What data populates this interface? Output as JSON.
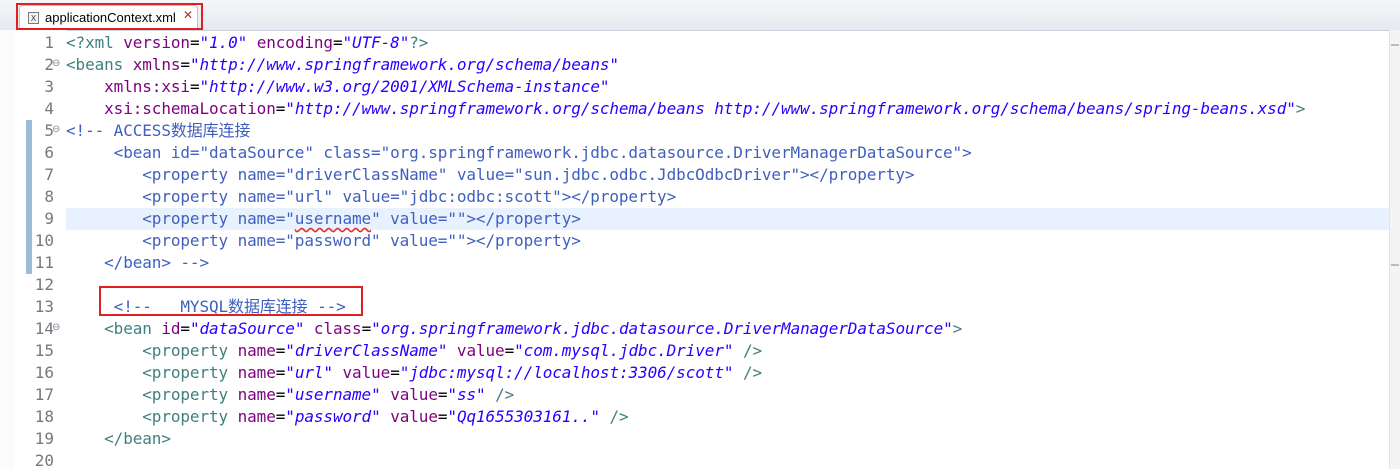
{
  "tab": {
    "title": "applicationContext.xml"
  },
  "lines": [
    {
      "n": "1",
      "fold": "",
      "hl": false,
      "segs": [
        [
          "t",
          "<?xml "
        ],
        [
          "a",
          "version"
        ],
        [
          "p",
          "="
        ],
        [
          "v",
          "\"1.0\""
        ],
        [
          "p",
          " "
        ],
        [
          "a",
          "encoding"
        ],
        [
          "p",
          "="
        ],
        [
          "v",
          "\"UTF-8\""
        ],
        [
          "t",
          "?>"
        ]
      ]
    },
    {
      "n": "2",
      "fold": "⊖",
      "hl": false,
      "segs": [
        [
          "t",
          "<beans "
        ],
        [
          "a",
          "xmlns"
        ],
        [
          "p",
          "="
        ],
        [
          "v",
          "\"http://www.springframework.org/schema/beans\""
        ]
      ]
    },
    {
      "n": "3",
      "fold": "",
      "hl": false,
      "segs": [
        [
          "p",
          "    "
        ],
        [
          "a",
          "xmlns:xsi"
        ],
        [
          "p",
          "="
        ],
        [
          "v",
          "\"http://www.w3.org/2001/XMLSchema-instance\""
        ]
      ]
    },
    {
      "n": "4",
      "fold": "",
      "hl": false,
      "segs": [
        [
          "p",
          "    "
        ],
        [
          "a",
          "xsi:schemaLocation"
        ],
        [
          "p",
          "="
        ],
        [
          "v",
          "\"http://www.springframework.org/schema/beans http://www.springframework.org/schema/beans/spring-beans.xsd\""
        ],
        [
          "t",
          ">"
        ]
      ]
    },
    {
      "n": "5",
      "fold": "⊖",
      "hl": false,
      "segs": [
        [
          "c",
          "<!-- ACCESS数据库连接"
        ]
      ]
    },
    {
      "n": "6",
      "fold": "",
      "hl": false,
      "segs": [
        [
          "c",
          "     <bean id=\"dataSource\" class=\"org.springframework.jdbc.datasource.DriverManagerDataSource\">"
        ]
      ]
    },
    {
      "n": "7",
      "fold": "",
      "hl": false,
      "segs": [
        [
          "c",
          "        <property name=\"driverClassName\" value=\"sun.jdbc.odbc.JdbcOdbcDriver\"></property>"
        ]
      ]
    },
    {
      "n": "8",
      "fold": "",
      "hl": false,
      "segs": [
        [
          "c",
          "        <property name=\"url\" value=\"jdbc:odbc:scott\"></property>"
        ]
      ]
    },
    {
      "n": "9",
      "fold": "",
      "hl": true,
      "segs": [
        [
          "c",
          "        <property name=\""
        ],
        [
          "cs",
          "username"
        ],
        [
          "c",
          "\" value=\"\"></property>"
        ]
      ]
    },
    {
      "n": "10",
      "fold": "",
      "hl": false,
      "segs": [
        [
          "c",
          "        <property name=\"password\" value=\"\"></property>"
        ]
      ]
    },
    {
      "n": "11",
      "fold": "",
      "hl": false,
      "segs": [
        [
          "c",
          "    </bean> -->"
        ]
      ]
    },
    {
      "n": "12",
      "fold": "",
      "hl": false,
      "segs": []
    },
    {
      "n": "13",
      "fold": "",
      "hl": false,
      "segs": [
        [
          "c",
          "     <!--   MYSQL数据库连接 -->"
        ]
      ]
    },
    {
      "n": "14",
      "fold": "⊖",
      "hl": false,
      "segs": [
        [
          "p",
          "    "
        ],
        [
          "t",
          "<bean "
        ],
        [
          "a",
          "id"
        ],
        [
          "p",
          "="
        ],
        [
          "v",
          "\"dataSource\""
        ],
        [
          "p",
          " "
        ],
        [
          "a",
          "class"
        ],
        [
          "p",
          "="
        ],
        [
          "v",
          "\"org.springframework.jdbc.datasource.DriverManagerDataSource\""
        ],
        [
          "t",
          ">"
        ]
      ]
    },
    {
      "n": "15",
      "fold": "",
      "hl": false,
      "segs": [
        [
          "p",
          "        "
        ],
        [
          "t",
          "<property "
        ],
        [
          "a",
          "name"
        ],
        [
          "p",
          "="
        ],
        [
          "v",
          "\"driverClassName\""
        ],
        [
          "p",
          " "
        ],
        [
          "a",
          "value"
        ],
        [
          "p",
          "="
        ],
        [
          "v",
          "\"com.mysql.jdbc.Driver\""
        ],
        [
          "p",
          " "
        ],
        [
          "t",
          "/>"
        ]
      ]
    },
    {
      "n": "16",
      "fold": "",
      "hl": false,
      "segs": [
        [
          "p",
          "        "
        ],
        [
          "t",
          "<property "
        ],
        [
          "a",
          "name"
        ],
        [
          "p",
          "="
        ],
        [
          "v",
          "\"url\""
        ],
        [
          "p",
          " "
        ],
        [
          "a",
          "value"
        ],
        [
          "p",
          "="
        ],
        [
          "v",
          "\"jdbc:mysql://localhost:3306/scott\""
        ],
        [
          "p",
          " "
        ],
        [
          "t",
          "/>"
        ]
      ]
    },
    {
      "n": "17",
      "fold": "",
      "hl": false,
      "segs": [
        [
          "p",
          "        "
        ],
        [
          "t",
          "<property "
        ],
        [
          "a",
          "name"
        ],
        [
          "p",
          "="
        ],
        [
          "v",
          "\"username\""
        ],
        [
          "p",
          " "
        ],
        [
          "a",
          "value"
        ],
        [
          "p",
          "="
        ],
        [
          "v",
          "\"ss\""
        ],
        [
          "p",
          " "
        ],
        [
          "t",
          "/>"
        ]
      ]
    },
    {
      "n": "18",
      "fold": "",
      "hl": false,
      "segs": [
        [
          "p",
          "        "
        ],
        [
          "t",
          "<property "
        ],
        [
          "a",
          "name"
        ],
        [
          "p",
          "="
        ],
        [
          "v",
          "\"password\""
        ],
        [
          "p",
          " "
        ],
        [
          "a",
          "value"
        ],
        [
          "p",
          "="
        ],
        [
          "v",
          "\"Qq1655303161..\""
        ],
        [
          "p",
          " "
        ],
        [
          "t",
          "/>"
        ]
      ]
    },
    {
      "n": "19",
      "fold": "",
      "hl": false,
      "segs": [
        [
          "p",
          "    "
        ],
        [
          "t",
          "</bean>"
        ]
      ]
    },
    {
      "n": "20",
      "fold": "",
      "hl": false,
      "segs": []
    }
  ]
}
